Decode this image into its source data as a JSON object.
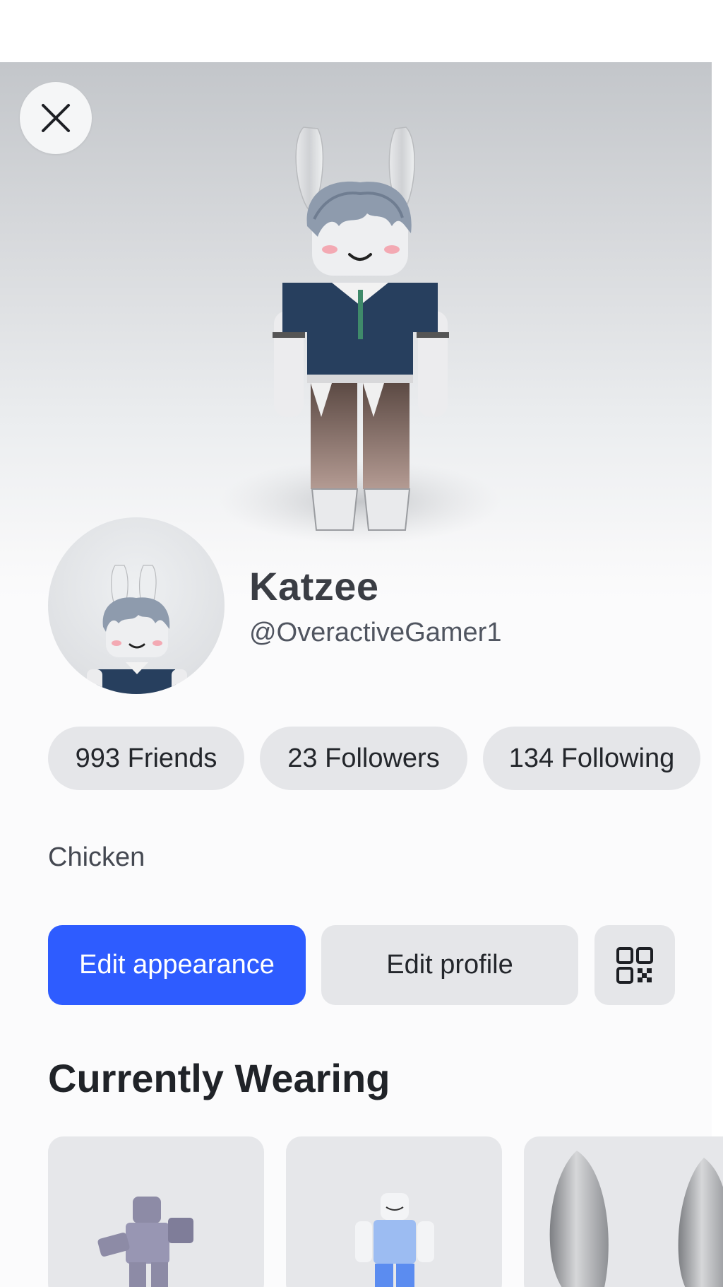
{
  "profile": {
    "display_name": "Katzee",
    "username": "@OveractiveGamer1",
    "bio": "Chicken"
  },
  "stats": {
    "friends": "993 Friends",
    "followers": "23 Followers",
    "following": "134 Following"
  },
  "actions": {
    "edit_appearance": "Edit appearance",
    "edit_profile": "Edit profile"
  },
  "section": {
    "currently_wearing": "Currently Wearing"
  },
  "icons": {
    "close": "close-icon",
    "qr": "qr-code-icon"
  },
  "colors": {
    "primary_button": "#2e5cff",
    "pill_background": "#e5e6e9"
  }
}
